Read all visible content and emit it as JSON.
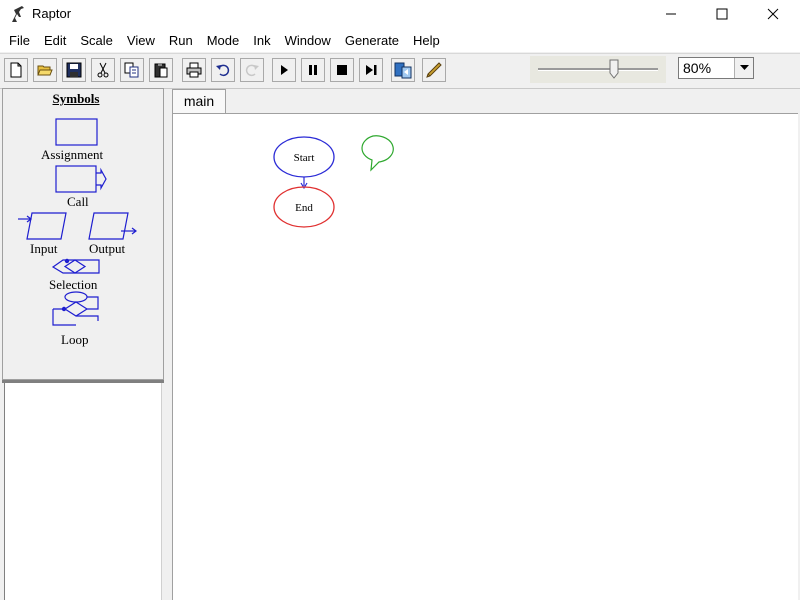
{
  "window": {
    "title": "Raptor",
    "icon": "raptor-dinosaur-icon"
  },
  "menu": {
    "items": [
      "File",
      "Edit",
      "Scale",
      "View",
      "Run",
      "Mode",
      "Ink",
      "Window",
      "Generate",
      "Help"
    ]
  },
  "toolbar": {
    "buttons": [
      "new-file-icon",
      "open-folder-icon",
      "save-disk-icon",
      "cut-scissors-icon",
      "copy-icon",
      "paste-icon",
      "print-icon",
      "undo-icon",
      "redo-icon",
      "play-icon",
      "pause-icon",
      "stop-icon",
      "step-icon",
      "test-server-icon",
      "pen-icon"
    ],
    "zoom": "80%",
    "zoom_slider_fraction": 0.63
  },
  "symbols": {
    "title": "Symbols",
    "assignment": "Assignment",
    "call": "Call",
    "input": "Input",
    "output": "Output",
    "selection": "Selection",
    "loop": "Loop"
  },
  "tabs": [
    {
      "label": "main",
      "active": true
    }
  ],
  "flowchart": {
    "start_label": "Start",
    "end_label": "End",
    "start_color": "#2b2bd6",
    "end_color": "#e03030",
    "comment_color": "#2ea82e"
  },
  "colors": {
    "symbol_stroke": "#1e1ed0"
  }
}
